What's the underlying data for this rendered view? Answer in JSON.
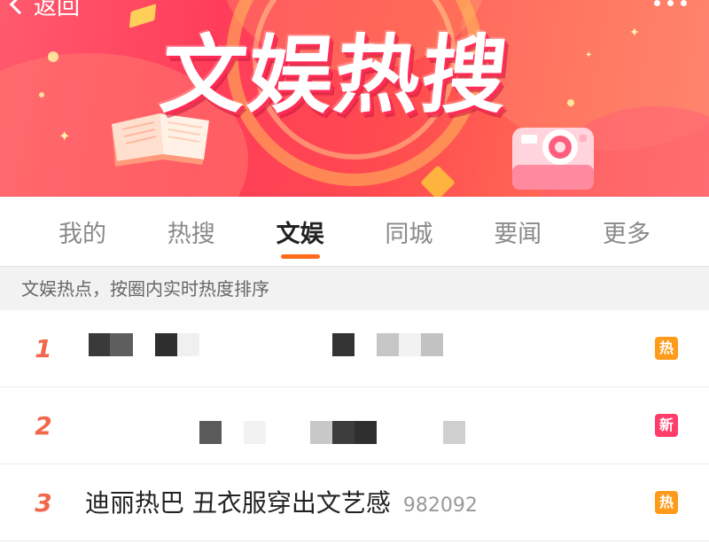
{
  "header": {
    "back_label": "返回",
    "title": "文娱热搜"
  },
  "tabs": [
    {
      "label": "我的",
      "active": false
    },
    {
      "label": "热搜",
      "active": false
    },
    {
      "label": "文娱",
      "active": true
    },
    {
      "label": "同城",
      "active": false
    },
    {
      "label": "要闻",
      "active": false
    },
    {
      "label": "更多",
      "active": false
    }
  ],
  "section": {
    "hint": "文娱热点，按圈内实时热度排序"
  },
  "list": {
    "items": [
      {
        "rank": "1",
        "title": "",
        "count": "",
        "redacted": true,
        "badge": "热",
        "badge_type": "hot"
      },
      {
        "rank": "2",
        "title": "",
        "count": "",
        "redacted": true,
        "badge": "新",
        "badge_type": "new"
      },
      {
        "rank": "3",
        "title": "迪丽热巴 丑衣服穿出文艺感",
        "count": "982092",
        "redacted": false,
        "badge": "热",
        "badge_type": "hot"
      }
    ]
  },
  "colors": {
    "banner_accent": "#ff3d5a",
    "tab_indicator": "#ff6a1a",
    "rank_color": "#f2674a",
    "badge_hot": "#ff9b1a",
    "badge_new": "#ff3d6b"
  },
  "icons": {
    "back": "chevron-left-icon",
    "more": "more-dots-icon",
    "book": "open-book-icon",
    "camera": "instant-camera-icon"
  }
}
